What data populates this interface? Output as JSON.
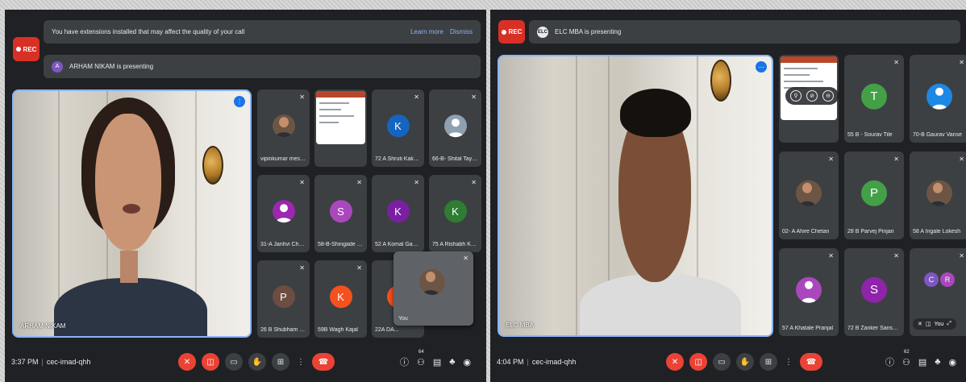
{
  "left": {
    "rec_label": "REC",
    "banner": {
      "message": "You have extensions installed that may affect the quality of your call",
      "learn_more": "Learn more",
      "dismiss": "Dismiss"
    },
    "presenting": {
      "initial": "A",
      "text": "ARHAM NIKAM is presenting"
    },
    "stage_label": "ARHAM NIKAM",
    "tiles": [
      {
        "name": "vipinkumar mesh...",
        "avatar": "photo"
      },
      {
        "name": "",
        "avatar": "slide"
      },
      {
        "name": "72 A Shruti Kakvi...",
        "initial": "K",
        "color": "#1565c0"
      },
      {
        "name": "66-B- Shital Tayde",
        "avatar": "person",
        "color": "#8fa1b0"
      },
      {
        "name": "31-A Janhvi Chan...",
        "avatar": "person",
        "color": "#9c27b0"
      },
      {
        "name": "58-B-Shingade S...",
        "initial": "S",
        "color": "#ab47bc"
      },
      {
        "name": "52 A Komal Gavh...",
        "initial": "K",
        "color": "#7b1fa2"
      },
      {
        "name": "75 A Rishabh Kod...",
        "initial": "K",
        "color": "#2e7d32"
      },
      {
        "name": "26 B Shubham Pa...",
        "initial": "P",
        "color": "#6d4c41"
      },
      {
        "name": "59B Wagh Kajal",
        "initial": "K",
        "color": "#f4511e"
      },
      {
        "name": "22A DA...",
        "initial": "",
        "color": "#f4511e"
      }
    ],
    "self_label": "You",
    "time": "3:37 PM",
    "meeting_code": "cec-imad-qhh",
    "participant_count": "64"
  },
  "right": {
    "rec_label": "REC",
    "presenting": {
      "logo": "ELC",
      "text": "ELC MBA is presenting"
    },
    "stage_label": "ELC MBA",
    "tiles": [
      {
        "name": "",
        "avatar": "slide"
      },
      {
        "name": "55 B - Sourav Tile",
        "initial": "T",
        "color": "#43a047"
      },
      {
        "name": "70-B Gaurav Vanse",
        "avatar": "person",
        "color": "#1e88e5"
      },
      {
        "name": "02- A Ahire Chetan",
        "avatar": "photo"
      },
      {
        "name": "28 B Parvej Pinjari",
        "initial": "P",
        "color": "#43a047"
      },
      {
        "name": "58 A Ingale Lokesh",
        "avatar": "photo"
      },
      {
        "name": "57 A Khatale Pranjal",
        "avatar": "person",
        "color": "#ab47bc"
      },
      {
        "name": "72 B Zanker Sanskruti",
        "initial": "S",
        "color": "#8e24aa"
      },
      {
        "name": "",
        "avatar": "group"
      }
    ],
    "group_initials": [
      "C",
      "R"
    ],
    "self_label": "You",
    "time": "4:04 PM",
    "meeting_code": "cec-imad-qhh",
    "participant_count": "62"
  },
  "icons": {
    "mic_off": "mic-off-icon",
    "cam_off": "camera-off-icon",
    "captions": "captions-icon",
    "hand": "raise-hand-icon",
    "present": "present-icon",
    "more": "more-icon",
    "end": "end-call-icon",
    "info": "info-icon",
    "people": "people-icon",
    "chat": "chat-icon",
    "activities": "activities-icon",
    "host": "host-controls-icon"
  },
  "colors": {
    "accent": "#8ab4f8",
    "danger": "#ea4335",
    "surface": "#3c4043",
    "background": "#202124"
  }
}
